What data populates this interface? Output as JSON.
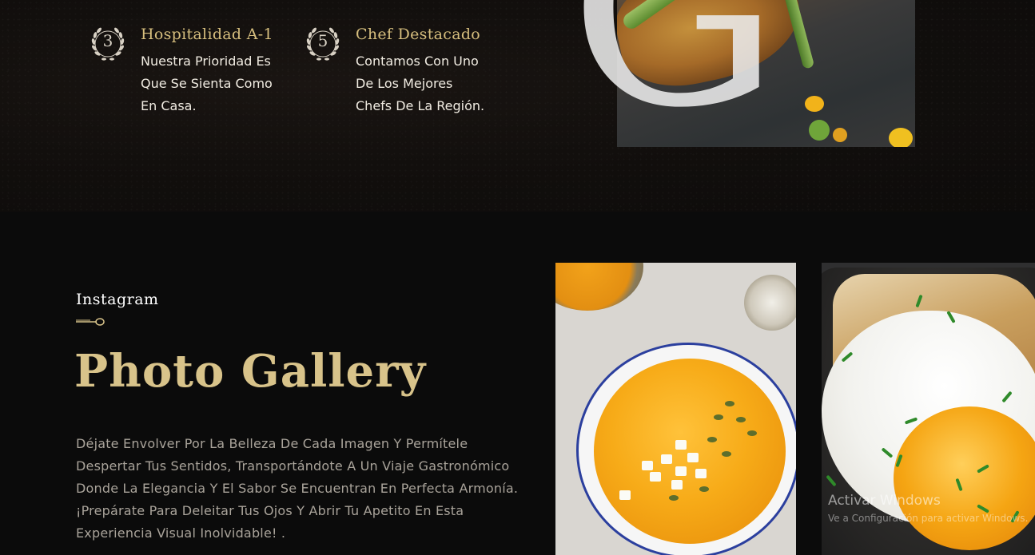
{
  "features": [
    {
      "number": "3",
      "title": "Hospitalidad A-1",
      "text_lines": [
        "Nuestra Prioridad Es",
        "Que Se Sienta Como",
        "En Casa."
      ]
    },
    {
      "number": "5",
      "title": "Chef Destacado",
      "text_lines": [
        "Contamos Con Uno",
        "De Los Mejores",
        "Chefs De La Región."
      ]
    }
  ],
  "hero_letter": "G",
  "gallery": {
    "label": "Instagram",
    "title": "Photo Gallery",
    "description": "Déjate Envolver Por La Belleza De Cada Imagen Y Permítele Despertar Tus Sentidos, Transportándote A Un Viaje Gastronómico Donde La Elegancia Y El Sabor Se Encuentran En Perfecta Armonía. ¡Prepárate Para Deleitar Tus Ojos Y Abrir Tu Apetito En Esta Experiencia Visual Inolvidable! ."
  },
  "watermark": {
    "title": "Activar Windows",
    "subtitle": "Ve a Configuración para activar Windows."
  },
  "colors": {
    "gold": "#d8c38a",
    "accent_title": "#d7bf7e",
    "background": "#0b0b0b"
  }
}
